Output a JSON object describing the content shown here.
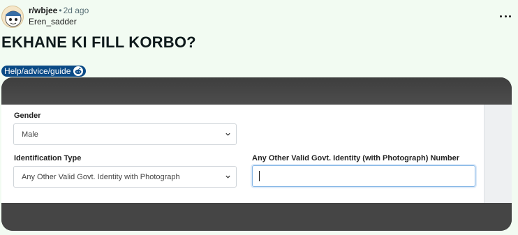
{
  "post": {
    "subreddit": "r/wbjee",
    "separator": "•",
    "age": "2d ago",
    "author": "Eren_sadder",
    "title": "EKHANE KI FILL KORBO?",
    "flair": "Help/advice/guide"
  },
  "form": {
    "gender_label": "Gender",
    "gender_value": "Male",
    "id_type_label": "Identification Type",
    "id_type_value": "Any Other Valid Govt. Identity with Photograph",
    "id_number_label": "Any Other Valid Govt. Identity (with Photograph) Number",
    "id_number_value": ""
  },
  "colors": {
    "background": "#f2fbf2",
    "flair_bg": "#0b4a86",
    "focus_border": "#86b7e6"
  }
}
